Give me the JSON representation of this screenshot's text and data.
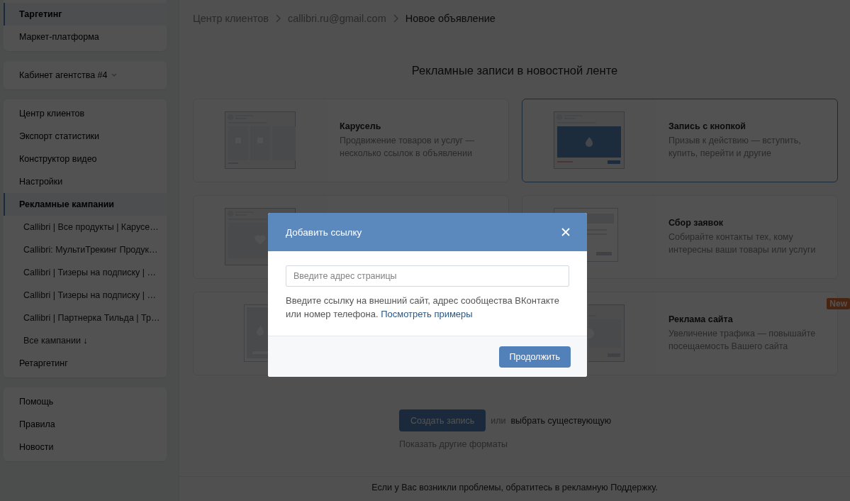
{
  "sidebar": {
    "groups": [
      {
        "items": [
          {
            "label": "Таргетинг",
            "selected": true
          },
          {
            "label": "Маркет-платформа",
            "selected": false
          }
        ]
      },
      {
        "items": [
          {
            "label": "Кабинет агентства #4",
            "selected": false,
            "kind": "dropdown"
          }
        ]
      },
      {
        "items": [
          {
            "label": "Центр клиентов",
            "selected": false
          },
          {
            "label": "Экспорт статистики",
            "selected": false
          },
          {
            "label": "Конструктор видео",
            "selected": false
          },
          {
            "label": "Настройки",
            "selected": false
          },
          {
            "label": "Рекламные кампании",
            "selected": true,
            "children": [
              {
                "label": "Callibri | Все продукты | Карусе…"
              },
              {
                "label": "Callibri: МультиТрекинг Продук…"
              },
              {
                "label": "Callibri | Тизеры на подписку | …"
              },
              {
                "label": "Callibri | Тизеры на подписку | …"
              },
              {
                "label": "Callibri | Партнерка Тильда | Тр…"
              },
              {
                "label": "Все кампании ↓"
              }
            ]
          },
          {
            "label": "Ретаргетинг",
            "selected": false
          }
        ]
      },
      {
        "items": [
          {
            "label": "Помощь",
            "selected": false
          },
          {
            "label": "Правила",
            "selected": false
          },
          {
            "label": "Новости",
            "selected": false
          }
        ]
      }
    ]
  },
  "breadcrumb": [
    "Центр клиентов",
    "callibri.ru@gmail.com",
    "Новое объявление"
  ],
  "heading": "Рекламные записи в новостной ленте",
  "cards": [
    {
      "kind": "carousel",
      "title": "Карусель",
      "description": "Продвижение товаров и услуг — несколько ссылок в объявлении",
      "selected": false
    },
    {
      "kind": "button",
      "title": "Запись с кнопкой",
      "description": "Призыв к действию — вступить, купить, перейти и другие",
      "selected": true
    },
    {
      "kind": "heart",
      "selected": false
    },
    {
      "kind": "leads",
      "title": "Сбор заявок",
      "description": "Собирайте контакты тех, кому интересны ваши товары или услуги",
      "selected": false
    },
    {
      "kind": "story",
      "selected": false
    },
    {
      "kind": "site",
      "title": "Реклама сайта",
      "description": "Увеличение трафика — повышайте посещаемость Вашего сайта",
      "selected": false,
      "badge": "New"
    }
  ],
  "actions": {
    "create_button": "Создать запись",
    "or_text": "или",
    "choose_link": "выбрать существующую",
    "more_link": "Показать другие форматы"
  },
  "footer": "Если у Вас возникли проблемы, обратитесь в рекламную Поддержку.",
  "modal": {
    "title": "Добавить ссылку",
    "input": {
      "placeholder": "Введите адрес страницы"
    },
    "help": "Введите ссылку на внешний сайт, адрес сообщества ВКонтакте или номер телефона.",
    "help_link": "Посмотреть примеры",
    "button": "Продолжить"
  }
}
